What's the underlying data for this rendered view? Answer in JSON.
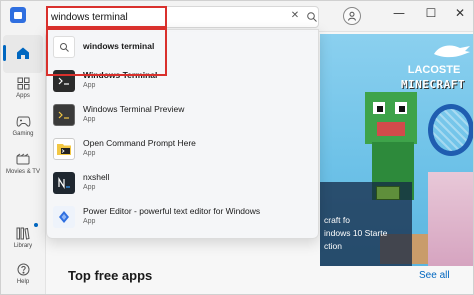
{
  "window": {
    "minimize_glyph": "—",
    "maximize_glyph": "☐",
    "close_glyph": "✕"
  },
  "search": {
    "value": "windows terminal",
    "clear_glyph": "✕"
  },
  "results": [
    {
      "title": "windows terminal",
      "subtitle": "",
      "icon": "search-icon",
      "kind": "suggestion"
    },
    {
      "title": "Windows Terminal",
      "subtitle": "App",
      "icon": "terminal-icon",
      "kind": "app"
    },
    {
      "title": "Windows Terminal Preview",
      "subtitle": "App",
      "icon": "terminal-preview-icon",
      "kind": "app"
    },
    {
      "title": "Open Command Prompt Here",
      "subtitle": "App",
      "icon": "command-prompt-icon",
      "kind": "app"
    },
    {
      "title": "nxshell",
      "subtitle": "App",
      "icon": "nxshell-icon",
      "kind": "app"
    },
    {
      "title": "Power Editor - powerful text editor for Windows",
      "subtitle": "App",
      "icon": "power-editor-icon",
      "kind": "app"
    }
  ],
  "sidebar": {
    "items": [
      {
        "label": "",
        "icon": "home-icon"
      },
      {
        "label": "Apps",
        "icon": "apps-icon"
      },
      {
        "label": "Gaming",
        "icon": "gaming-icon"
      },
      {
        "label": "Movies & TV",
        "icon": "movies-icon"
      },
      {
        "label": "Library",
        "icon": "library-icon"
      },
      {
        "label": "Help",
        "icon": "help-icon"
      }
    ]
  },
  "hero": {
    "brand": "LACOSTE",
    "game": "MINECRAFT",
    "card_line1": "craft fo",
    "card_line2": "indows 10 Starte",
    "card_line3": "ction"
  },
  "main": {
    "section_title": "Top free apps",
    "see_all": "See all"
  },
  "colors": {
    "accent": "#0067c0",
    "highlight_red": "#d9302c"
  }
}
